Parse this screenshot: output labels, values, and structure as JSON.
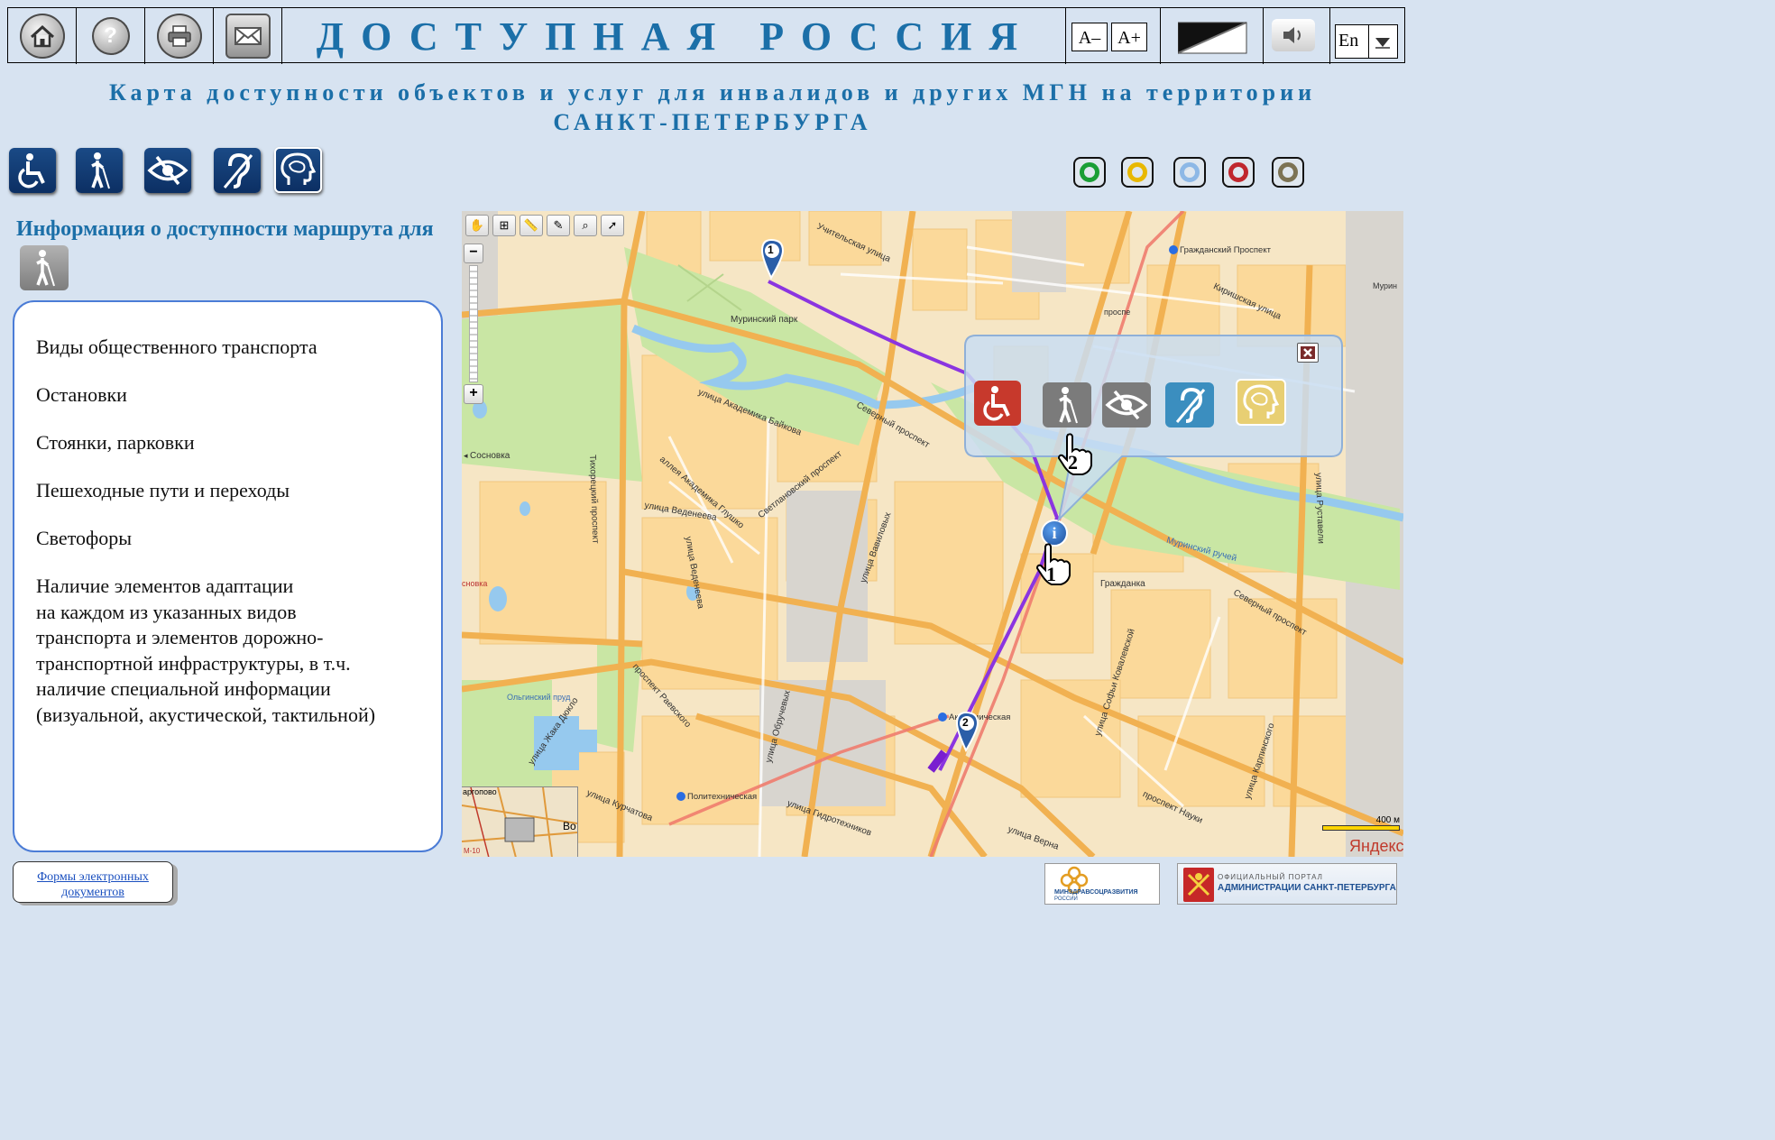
{
  "header": {
    "title": "ДОСТУПНАЯ РОССИЯ",
    "buttons": [
      {
        "name": "home",
        "icon": "home-icon"
      },
      {
        "name": "help",
        "icon": "question-icon"
      },
      {
        "name": "print",
        "icon": "printer-icon"
      },
      {
        "name": "mail",
        "icon": "envelope-icon"
      }
    ],
    "font_decrease": "A–",
    "font_increase": "A+",
    "contrast_icon": "contrast-icon",
    "sound_icon": "speaker-icon",
    "language": "En"
  },
  "subtitle_line1": "Карта доступности объектов и услуг для инвалидов и других МГН на территории",
  "subtitle_line2": "САНКТ-ПЕТЕРБУРГА",
  "categories": [
    "wheelchair-icon",
    "blind-person-icon",
    "visually-impaired-icon",
    "hearing-impaired-icon",
    "mental-impairment-icon"
  ],
  "legend_colors": [
    "#1a9e35",
    "#e8b800",
    "#8db8e6",
    "#c0272d",
    "#7c7354"
  ],
  "route": {
    "title": "Информация о доступности маршрута для"
  },
  "panel": {
    "items": [
      "Виды общественного транспорта",
      "Остановки",
      "Стоянки, парковки",
      "Пешеходные пути и переходы",
      "Светофоры"
    ],
    "paragraph_lines": [
      "Наличие элементов адаптации",
      "на каждом из указанных видов",
      "транспорта и элементов дорожно-",
      "транспортной инфраструктуры, в т.ч.",
      "наличие специальной информации",
      "(визуальной, акустической, тактильной)"
    ]
  },
  "map": {
    "labels": {
      "street_uchitelskaya": "Учительская улица",
      "metro_grazhdansky": "Гражданский Проспект",
      "street_kirishskaya": "Киришская улица",
      "murinsky_park": "Муринский парк",
      "murino_edge": "Мурин",
      "prosp_short": "проспе",
      "street_baykova": "улица Академика Байкова",
      "severny_prosp": "Северный проспект",
      "tikhoretsky": "Тихорецкий проспект",
      "sosnovka": "Сосновка",
      "sosnovka2": "сновка",
      "alley_glushko": "аллея Академика Глушко",
      "svetlanovsky": "Светлановский проспект",
      "vedeneeva": "улица Веденеева",
      "vedeneeva2": "улица Веденеева",
      "vavilovykh": "улица Вавиловых",
      "grazhdanka": "Гражданка",
      "murinsky_ruchey": "Муринский ручей",
      "severny_prosp2": "Северный проспект",
      "ruchyovskaya": "улица Руставели",
      "raevskogo": "проспект Раевского",
      "olginsky_prud": "Ольгинский пруд",
      "obruchevykh": "улица Обручевых",
      "metro_akademicheskaya": "Академическая",
      "sofya_kovalevskoy": "улица Софьи Ковалевской",
      "zhaka_dyuklo": "улица Жака Дюкло",
      "kurchatova": "улица Курчатова",
      "metro_polytech": "Политехническая",
      "gidrotekhnikov": "улица Гидротехников",
      "prosp_nauki": "проспект Науки",
      "karpinskogo": "улица Карпинского",
      "vernadskogo": "улица Верна",
      "argolovo": "аргопово",
      "v_label": "Во",
      "m10": "М-10",
      "scale": "400 м",
      "yandex": "Яндекс"
    },
    "markers": {
      "start": "1",
      "end": "2"
    },
    "pointers": {
      "first": "1",
      "second": "2"
    },
    "tools": [
      "hand-icon",
      "zoom-icon",
      "ruler-icon",
      "brush-icon",
      "magnifier-icon",
      "cursor-icon"
    ],
    "popup_icons": [
      {
        "name": "wheelchair-icon",
        "color": "#c7392c"
      },
      {
        "name": "blind-person-icon",
        "color": "#7b7b7b"
      },
      {
        "name": "visually-impaired-icon",
        "color": "#7b7b7b"
      },
      {
        "name": "hearing-impaired-icon",
        "color": "#3b8ebf"
      },
      {
        "name": "mental-impairment-icon",
        "color": "#e8cf73"
      }
    ]
  },
  "footer": {
    "forms_line1": "Формы электронных",
    "forms_line2": "документов",
    "logo1_text": "МИНЗДРАВСОЦРАЗВИТИЯ",
    "logo1_sub": "РОССИИ",
    "logo2_top": "ОФИЦИАЛЬНЫЙ ПОРТАЛ",
    "logo2_main": "АДМИНИСТРАЦИИ САНКТ-ПЕТЕРБУРГА"
  }
}
